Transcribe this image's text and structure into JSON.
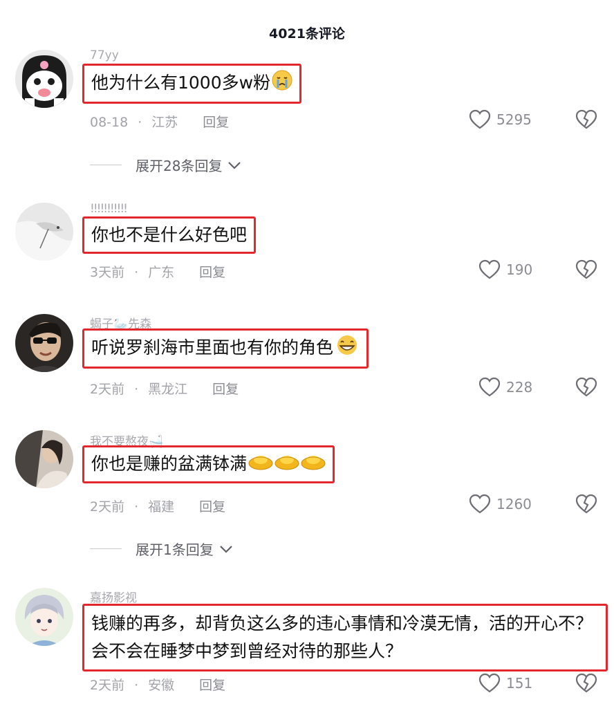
{
  "header": {
    "title": "4021条评论"
  },
  "comments": [
    {
      "username": "77yy",
      "text": "他为什么有1000多w粉",
      "date": "08-18",
      "location": "江苏",
      "reply_label": "回复",
      "likes": "5295",
      "avatar_icon": "cartoon-mask-avatar",
      "emoji_icons": [
        "crying-face-emoji"
      ],
      "expand_label": "展开28条回复"
    },
    {
      "username": "!!!!!!!!!!!",
      "text": "你也不是什么好色吧",
      "date": "3天前",
      "location": "广东",
      "reply_label": "回复",
      "likes": "190",
      "avatar_icon": "bird-photo-avatar"
    },
    {
      "username": "蝎子🦢先森",
      "text": "听说罗刹海市里面也有你的角色",
      "date": "2天前",
      "location": "黑龙江",
      "reply_label": "回复",
      "likes": "228",
      "avatar_icon": "sunglasses-person-avatar",
      "emoji_icons": [
        "grinning-face-emoji"
      ]
    },
    {
      "username": "我不要熬夜🛁",
      "text": "你也是赚的盆满钵满",
      "date": "2天前",
      "location": "福建",
      "reply_label": "回复",
      "likes": "1260",
      "avatar_icon": "woman-photo-avatar",
      "emoji_icons": [
        "gold-ingot-emoji",
        "gold-ingot-emoji",
        "gold-ingot-emoji"
      ],
      "expand_label": "展开1条回复"
    },
    {
      "username": "嘉扬影视",
      "text": "钱赚的再多，却背负这么多的违心事情和冷漠无情，活的开心不？会不会在睡梦中梦到曾经对待的那些人？",
      "date": "2天前",
      "location": "安徽",
      "reply_label": "回复",
      "likes": "151",
      "avatar_icon": "anime-boy-avatar"
    }
  ],
  "colors": {
    "highlight_border": "#e3272d",
    "meta_text": "#a2a3a8",
    "username_text": "#a8a8ae"
  },
  "icons": {
    "like": "heart-outline-icon",
    "dislike": "broken-heart-icon",
    "expand": "chevron-down-icon"
  }
}
